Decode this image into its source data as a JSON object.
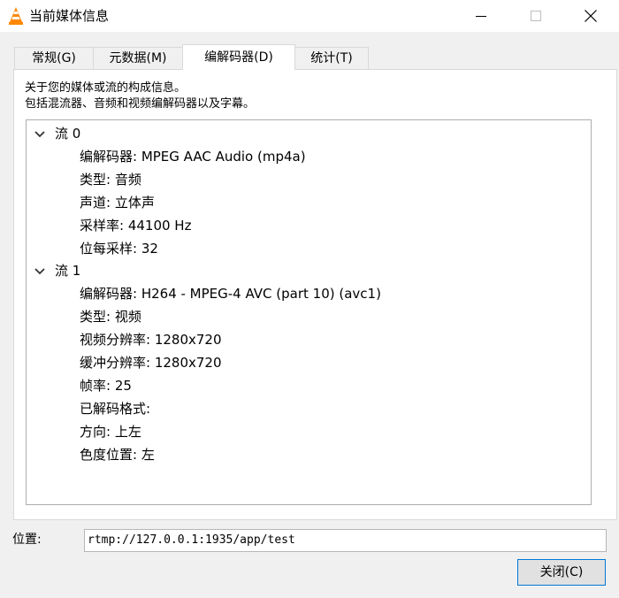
{
  "window": {
    "title": "当前媒体信息",
    "icon": "vlc-cone-icon",
    "controls": [
      "minimize-icon",
      "maximize-icon",
      "close-icon"
    ]
  },
  "tabs": [
    {
      "label": "常规(G)",
      "active": false
    },
    {
      "label": "元数据(M)",
      "active": false
    },
    {
      "label": "编解码器(D)",
      "active": true
    },
    {
      "label": "统计(T)",
      "active": false
    }
  ],
  "description": {
    "line1": "关于您的媒体或流的构成信息。",
    "line2": "包括混流器、音频和视频编解码器以及字幕。"
  },
  "streams": [
    {
      "label": "流 0",
      "expanded": true,
      "props": [
        "编解码器: MPEG AAC Audio (mp4a)",
        "类型: 音频",
        "声道: 立体声",
        "采样率: 44100 Hz",
        "位每采样: 32"
      ]
    },
    {
      "label": "流 1",
      "expanded": true,
      "props": [
        "编解码器: H264 - MPEG-4 AVC (part 10) (avc1)",
        "类型: 视频",
        "视频分辨率: 1280x720",
        "缓冲分辨率: 1280x720",
        "帧率: 25",
        "已解码格式:",
        "方向: 上左",
        "色度位置: 左"
      ]
    }
  ],
  "location": {
    "label": "位置:",
    "value": "rtmp://127.0.0.1:1935/app/test"
  },
  "close_button": {
    "label": "关闭(C)"
  },
  "colors": {
    "vlc_orange": "#ff8800",
    "focus_border": "#0078d7"
  }
}
